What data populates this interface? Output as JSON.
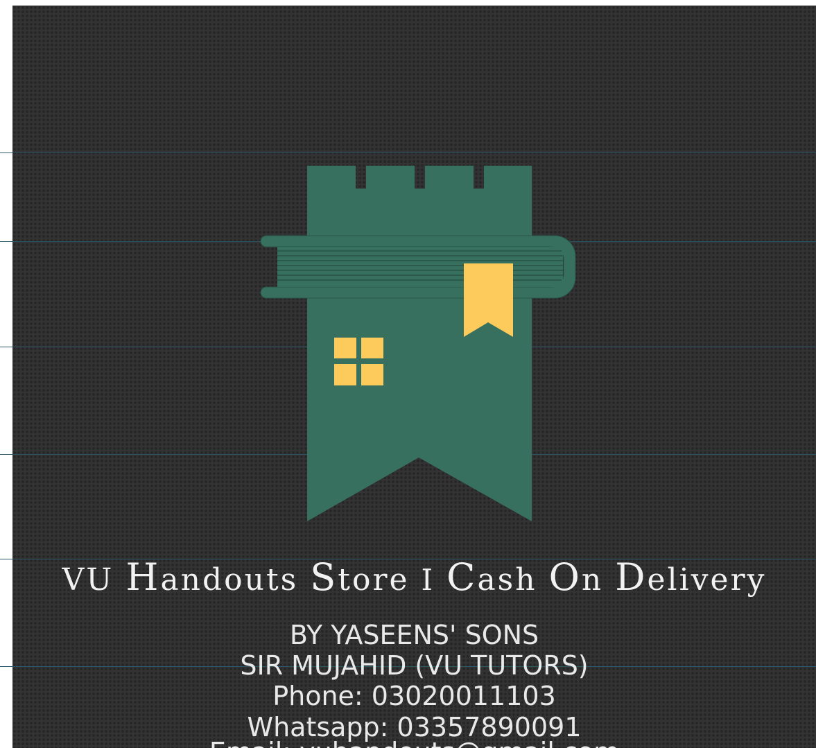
{
  "title": {
    "word1": "VU",
    "word2_initial": "H",
    "word2_rest": "andouts",
    "word3_initial": "S",
    "word3_rest": "tore",
    "separator": "I",
    "word4_initial": "C",
    "word4_rest": "ash",
    "word5_initial": "O",
    "word5_rest": "n",
    "word6_initial": "D",
    "word6_rest": "elivery"
  },
  "info": {
    "by": "BY YASEENS' SONS",
    "sir": "SIR MUJAHID (VU TUTORS)",
    "phone": "Phone: 03020011103",
    "whatsapp": "Whatsapp: 03357890091",
    "email": "Email: vuhandouts@gmail.com"
  },
  "logo": {
    "icon": "tower-book-bookmark-icon",
    "tower_color": "#37705f",
    "book_color": "#37705f",
    "accent_color": "#fdcb5c",
    "background_color": "#333333"
  }
}
